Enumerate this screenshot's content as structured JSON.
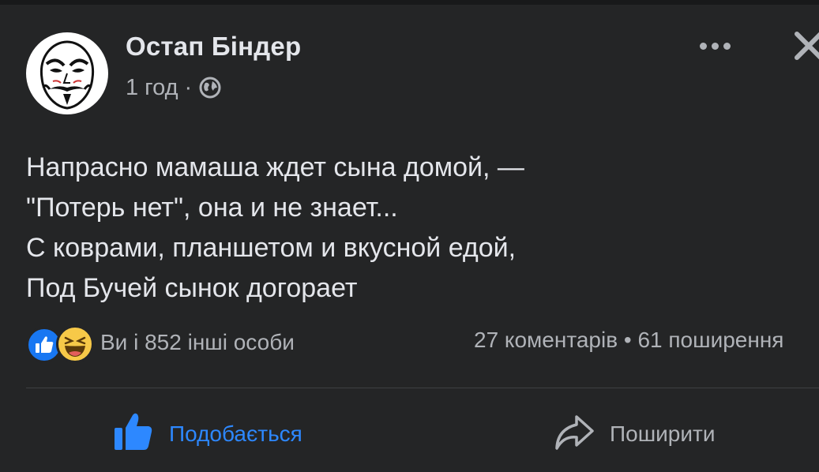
{
  "post": {
    "author": "Остап Біндер",
    "time": "1 год",
    "separator": "·",
    "audience_icon": "globe-icon",
    "lines": [
      "Напрасно мамаша ждет сына домой, —",
      "\"Потерь нет\", она и не знает...",
      "С коврами, планшетом и вкусной едой,",
      "Под Бучей сынок догорает"
    ]
  },
  "reactions": {
    "icons": [
      "like-icon",
      "haha-icon"
    ],
    "text": "Ви і 852 інші особи",
    "counts": "27 коментарів • 61 поширення"
  },
  "actions": {
    "like_label": "Подобається",
    "share_label": "Поширити"
  },
  "colors": {
    "background": "#242526",
    "text": "#e4e6eb",
    "secondary": "#b0b3b8",
    "accent": "#2d88ff",
    "like": "#1877f2",
    "haha": "#f7c948"
  }
}
